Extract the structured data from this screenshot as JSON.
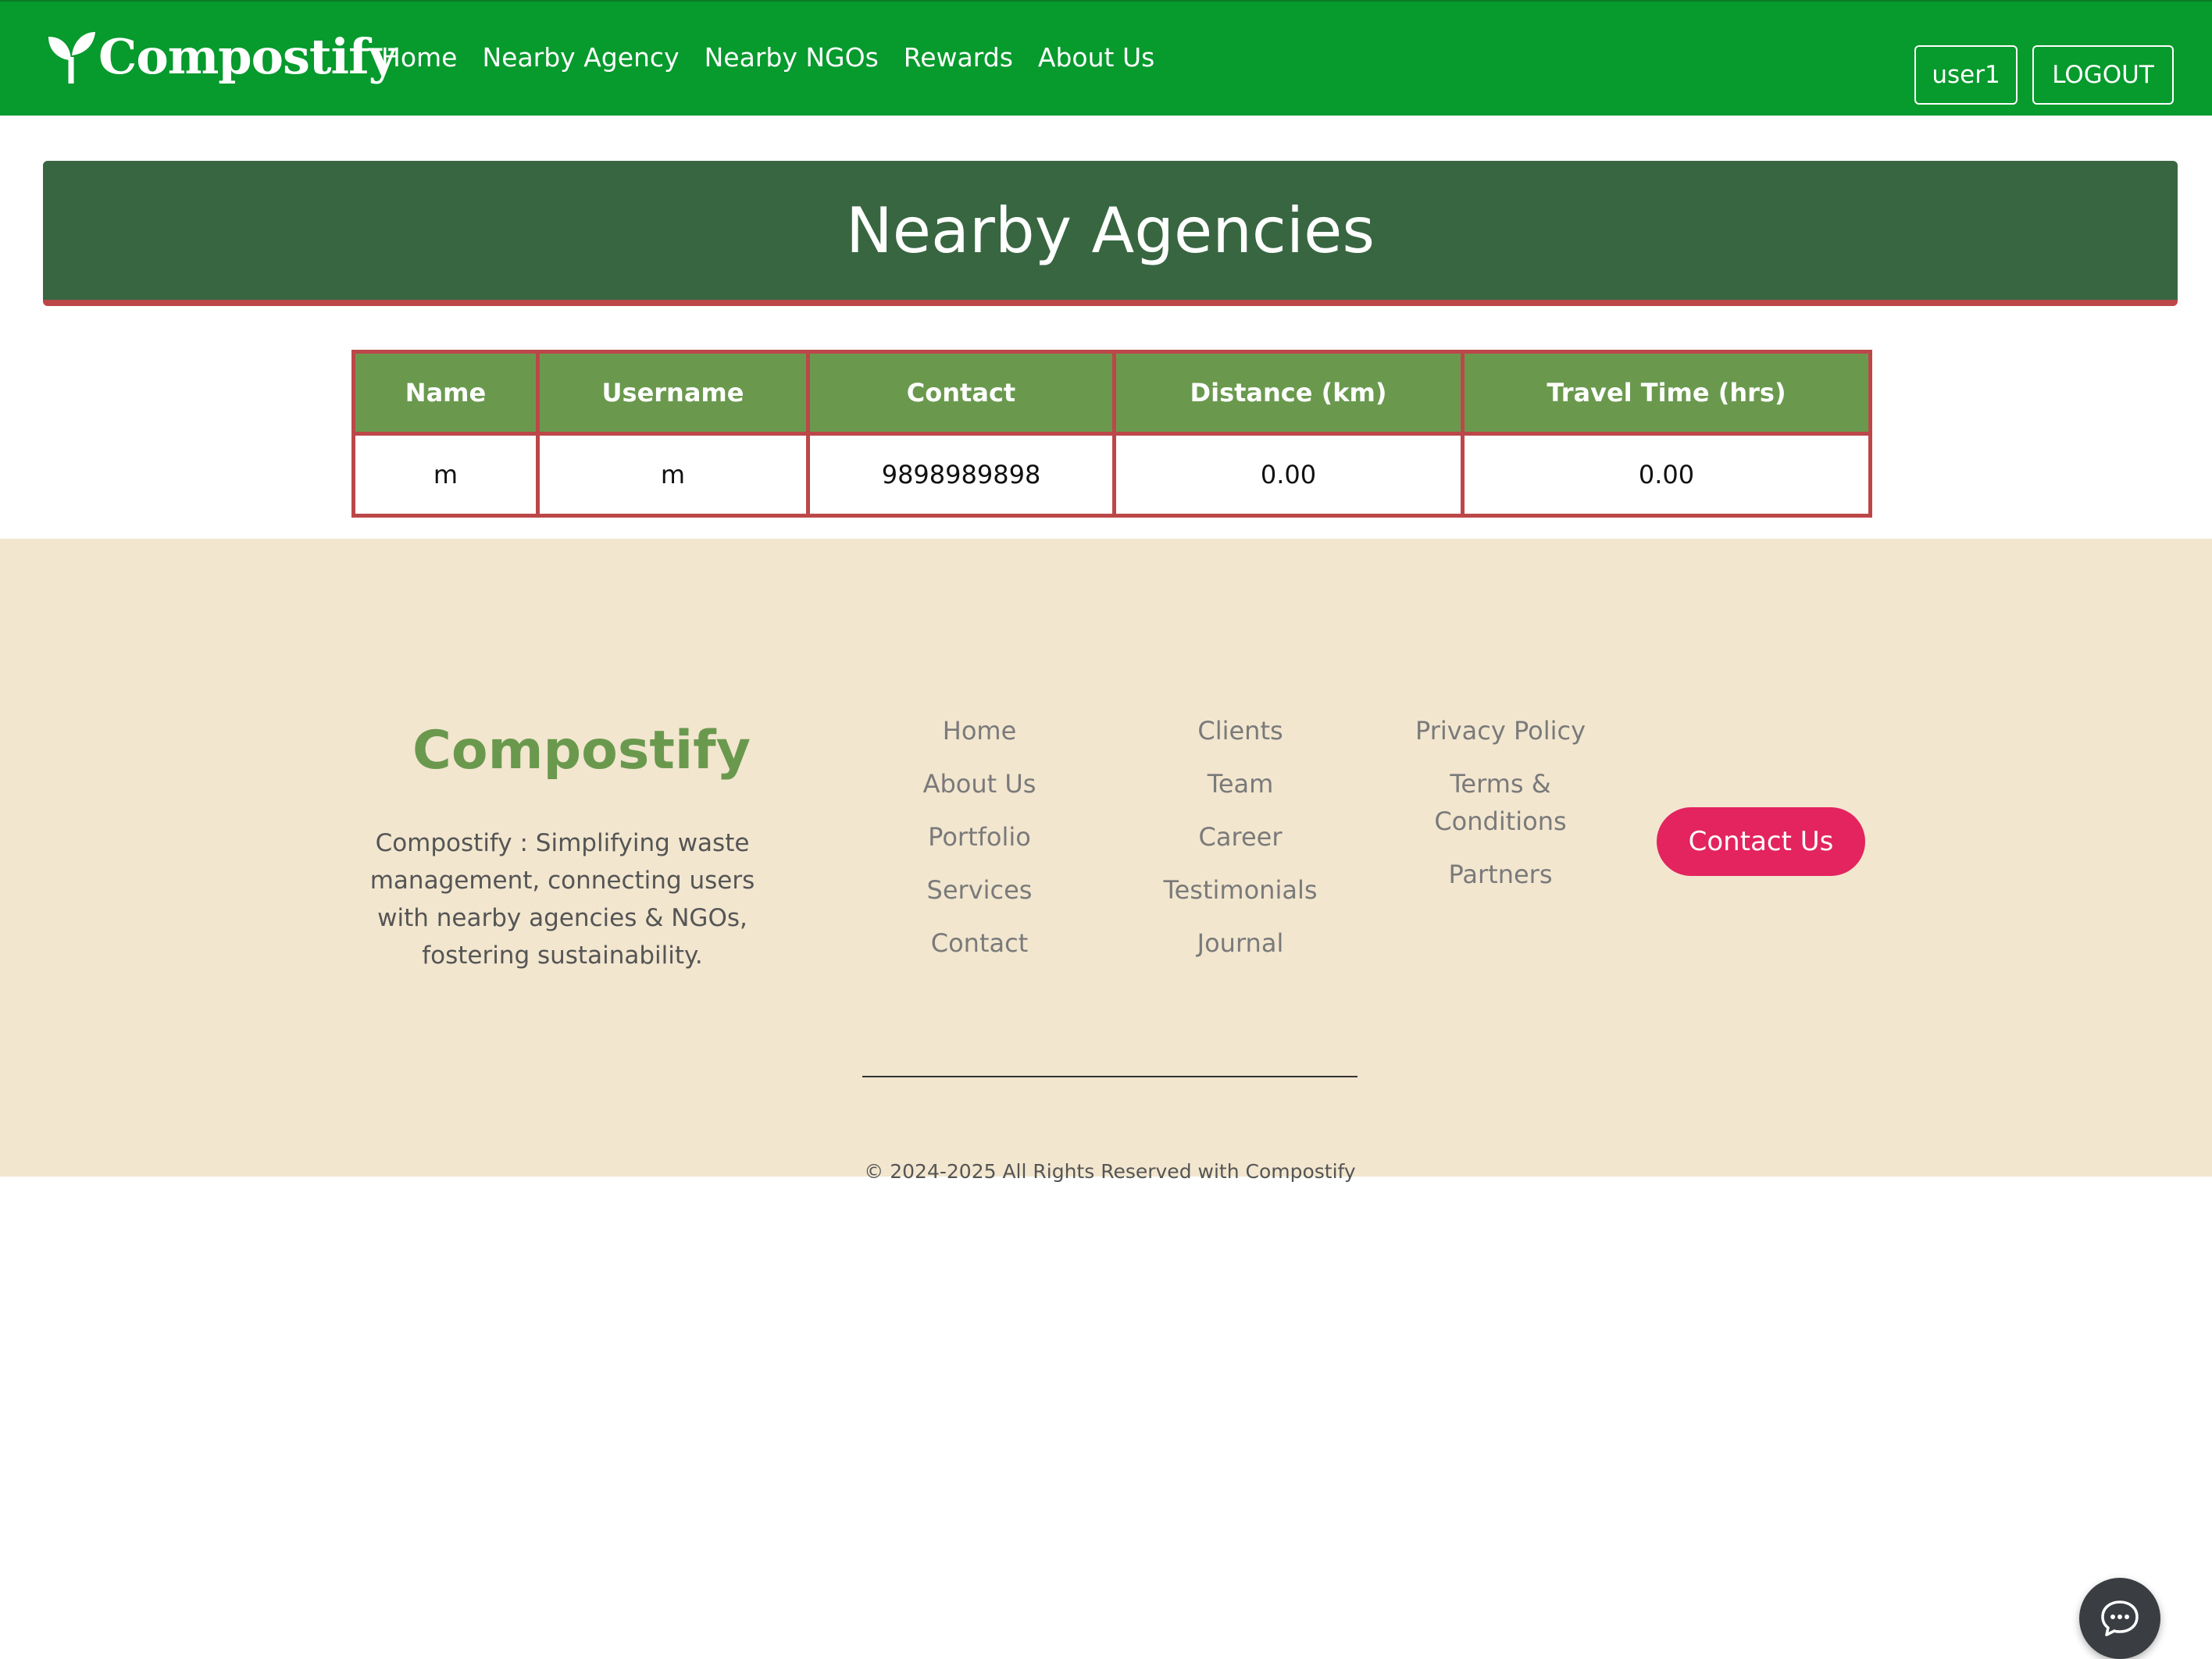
{
  "header": {
    "brand": "Compostify",
    "nav": [
      "Home",
      "Nearby Agency",
      "Nearby NGOs",
      "Rewards",
      "About Us"
    ],
    "user_label": "user1",
    "logout_label": "LOGOUT",
    "logo_icon": "sprout-icon",
    "bg_color": "#079a2d"
  },
  "banner": {
    "title": "Nearby Agencies",
    "bg_color": "#386641",
    "border_color": "#bc4749"
  },
  "table": {
    "columns": [
      "Name",
      "Username",
      "Contact",
      "Distance (km)",
      "Travel Time (hrs)"
    ],
    "rows": [
      [
        "m",
        "m",
        "9898989898",
        "0.00",
        "0.00"
      ]
    ],
    "header_color": "#6a994e",
    "border_color": "#bc4749"
  },
  "footer": {
    "brand": "Compostify",
    "description": "Compostify : Simplifying waste management, connecting users with nearby agencies & NGOs, fostering sustainability.",
    "col1": [
      "Home",
      "About Us",
      "Portfolio",
      "Services",
      "Contact"
    ],
    "col2": [
      "Clients",
      "Team",
      "Career",
      "Testimonials",
      "Journal"
    ],
    "col3": [
      "Privacy Policy",
      "Terms & Conditions",
      "Partners"
    ],
    "contact_button": "Contact Us",
    "copyright": "© 2024-2025 All Rights Reserved with Compostify",
    "bg_color": "#f2e6cf",
    "chat_icon": "chat-bubble-icon"
  }
}
